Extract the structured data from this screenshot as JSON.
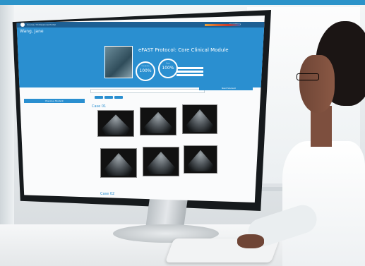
{
  "accent_color": "#2a8fd0",
  "header_color": "#1d5f93",
  "app": {
    "title": "Course / Professional Portal",
    "user": "Jane Wang",
    "menu_icon": "grid-icon",
    "avatar_icon": "user-icon"
  },
  "patient": {
    "name": "Wang, Jane"
  },
  "module": {
    "title": "eFAST Protocol: Core Clinical Module",
    "completion_label": "Completion",
    "completion_value": "100%",
    "score_label": "Score",
    "score_value": "100%",
    "completion_fraction": 1.0,
    "score_fraction": 1.0
  },
  "panels": {
    "left_button": "Previous Student",
    "right_button": "Next Student"
  },
  "cases": {
    "case1_title": "Case 01",
    "case2_title": "Case 02"
  },
  "thumbnails": [
    {
      "caption": ""
    },
    {
      "caption": ""
    },
    {
      "caption": ""
    },
    {
      "caption": ""
    },
    {
      "caption": ""
    },
    {
      "caption": ""
    }
  ]
}
